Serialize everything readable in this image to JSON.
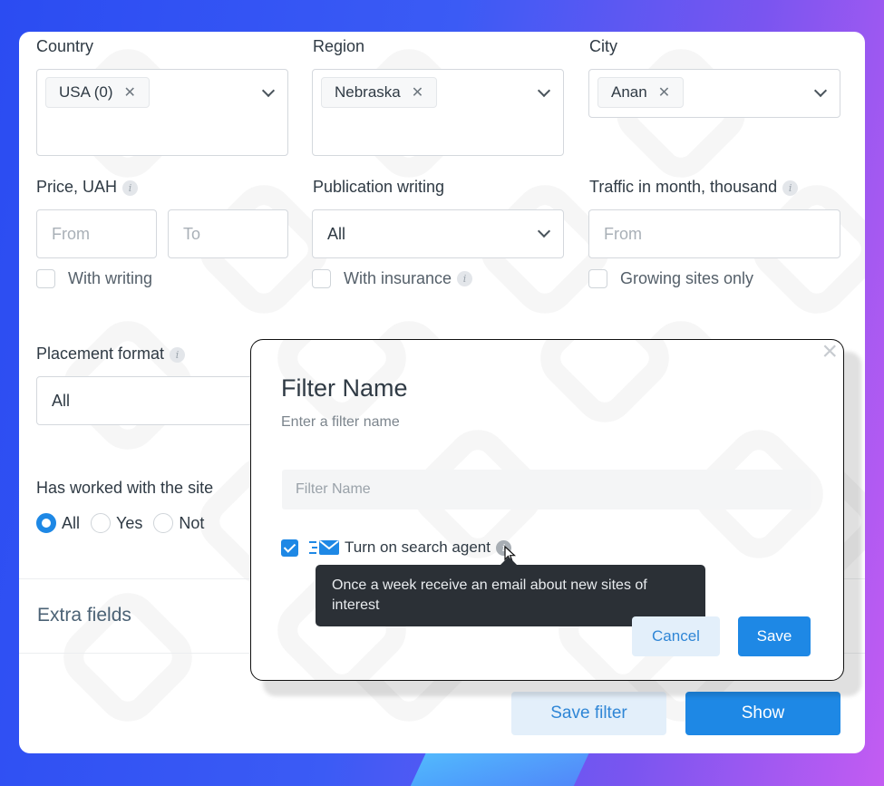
{
  "filters": {
    "country": {
      "label": "Country",
      "chip": "USA (0)"
    },
    "region": {
      "label": "Region",
      "chip": "Nebraska"
    },
    "city": {
      "label": "City",
      "chip": "Anan"
    },
    "price": {
      "label": "Price, UAH",
      "from_placeholder": "From",
      "to_placeholder": "To",
      "checkbox": "With writing"
    },
    "publication": {
      "label": "Publication writing",
      "value": "All",
      "checkbox": "With insurance"
    },
    "traffic": {
      "label": "Traffic in month, thousand",
      "from_placeholder": "From",
      "checkbox": "Growing sites only"
    },
    "placement": {
      "label": "Placement format",
      "value": "All"
    },
    "worked": {
      "label": "Has worked with the site",
      "options": [
        "All",
        "Yes",
        "Not"
      ],
      "selected": "All"
    },
    "extra_fields": "Extra fields"
  },
  "actions": {
    "save_filter": "Save filter",
    "show": "Show"
  },
  "modal": {
    "title": "Filter Name",
    "subtitle": "Enter a filter name",
    "input_placeholder": "Filter Name",
    "agent_label": "Turn on search agent",
    "agent_checked": true,
    "tooltip": "Once a week receive an email about new sites of interest",
    "cancel": "Cancel",
    "save": "Save",
    "close": "×"
  },
  "colors": {
    "accent": "#1e88e5",
    "accent_light": "#e3effa",
    "tooltip_bg": "#2b3036"
  }
}
